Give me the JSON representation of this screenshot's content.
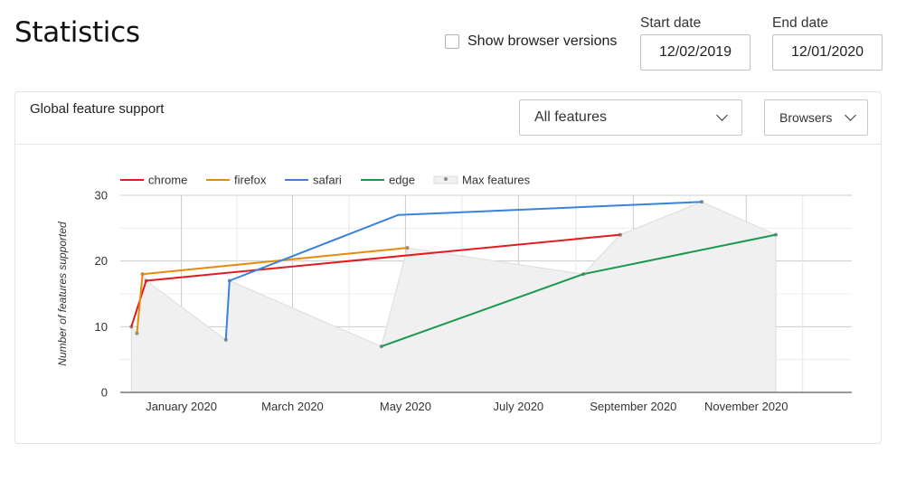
{
  "header": {
    "title": "Statistics",
    "show_versions_label": "Show browser versions",
    "show_versions_checked": false,
    "start_date_label": "Start date",
    "start_date_value": "12/02/2019",
    "end_date_label": "End date",
    "end_date_value": "12/01/2020"
  },
  "card": {
    "title": "Global feature support",
    "feature_select_value": "All features",
    "browser_select_value": "Browsers"
  },
  "chart_data": {
    "type": "line",
    "ylabel": "Number of features supported",
    "xlabel": "",
    "ylim": [
      0,
      30
    ],
    "yticks": [
      0,
      10,
      20,
      30
    ],
    "xlim": [
      "2019-11-29",
      "2020-12-28"
    ],
    "xticks": [
      {
        "date": "2020-01-01",
        "label": "January 2020"
      },
      {
        "date": "2020-03-01",
        "label": "March 2020"
      },
      {
        "date": "2020-05-01",
        "label": "May 2020"
      },
      {
        "date": "2020-07-01",
        "label": "July 2020"
      },
      {
        "date": "2020-09-01",
        "label": "September 2020"
      },
      {
        "date": "2020-11-01",
        "label": "November 2020"
      }
    ],
    "grid": true,
    "legend_position": "top-left",
    "series": [
      {
        "name": "chrome",
        "color": "#e41a1c",
        "points": [
          {
            "x": "2019-12-05",
            "y": 10
          },
          {
            "x": "2019-12-13",
            "y": 17
          },
          {
            "x": "2020-08-25",
            "y": 24
          }
        ]
      },
      {
        "name": "firefox",
        "color": "#e8890c",
        "points": [
          {
            "x": "2019-12-08",
            "y": 9
          },
          {
            "x": "2019-12-11",
            "y": 18
          },
          {
            "x": "2020-05-02",
            "y": 22
          }
        ]
      },
      {
        "name": "safari",
        "color": "#3b82dc",
        "points": [
          {
            "x": "2020-01-25",
            "y": 8
          },
          {
            "x": "2020-01-27",
            "y": 17
          },
          {
            "x": "2020-04-27",
            "y": 27
          },
          {
            "x": "2020-10-08",
            "y": 29
          }
        ]
      },
      {
        "name": "edge",
        "color": "#1a9850",
        "points": [
          {
            "x": "2020-04-18",
            "y": 7
          },
          {
            "x": "2020-08-05",
            "y": 18
          },
          {
            "x": "2020-11-17",
            "y": 24
          }
        ]
      }
    ],
    "max_features": {
      "name": "Max features",
      "color": "#d6d6d6",
      "points": [
        {
          "x": "2019-12-05",
          "y": 10
        },
        {
          "x": "2019-12-08",
          "y": 9
        },
        {
          "x": "2019-12-11",
          "y": 18
        },
        {
          "x": "2019-12-13",
          "y": 17
        },
        {
          "x": "2020-01-25",
          "y": 8
        },
        {
          "x": "2020-01-27",
          "y": 17
        },
        {
          "x": "2020-04-18",
          "y": 7
        },
        {
          "x": "2020-05-02",
          "y": 22
        },
        {
          "x": "2020-08-05",
          "y": 18
        },
        {
          "x": "2020-08-25",
          "y": 24
        },
        {
          "x": "2020-10-08",
          "y": 29
        },
        {
          "x": "2020-11-17",
          "y": 24
        }
      ]
    }
  }
}
